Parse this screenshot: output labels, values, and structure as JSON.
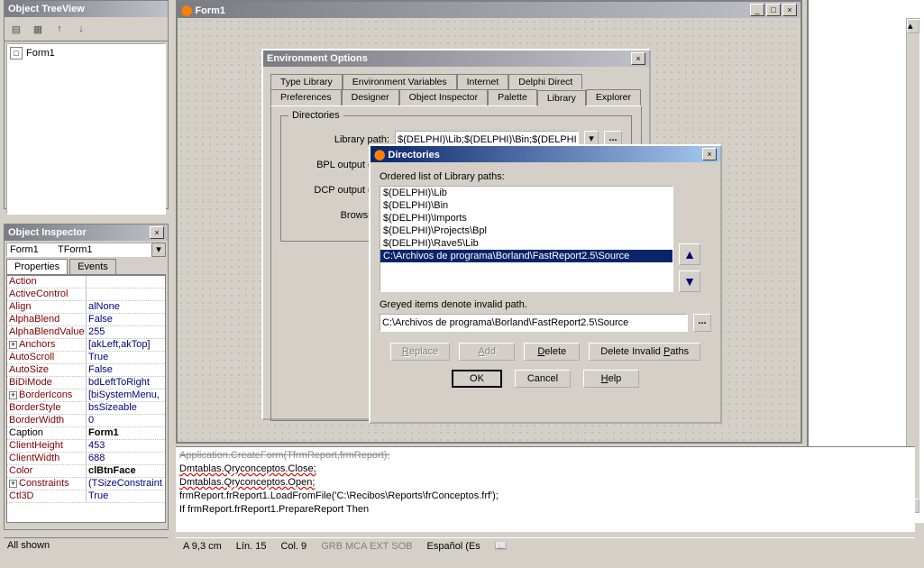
{
  "tree": {
    "title": "Object TreeView",
    "item": "Form1"
  },
  "inspector": {
    "title": "Object Inspector",
    "combo_name": "Form1",
    "combo_type": "TForm1",
    "tabs": {
      "properties": "Properties",
      "events": "Events"
    },
    "props": [
      {
        "name": "Action",
        "val": ""
      },
      {
        "name": "ActiveControl",
        "val": ""
      },
      {
        "name": "Align",
        "val": "alNone"
      },
      {
        "name": "AlphaBlend",
        "val": "False"
      },
      {
        "name": "AlphaBlendValue",
        "val": "255"
      },
      {
        "name": "Anchors",
        "val": "[akLeft,akTop]",
        "exp": true
      },
      {
        "name": "AutoScroll",
        "val": "True"
      },
      {
        "name": "AutoSize",
        "val": "False"
      },
      {
        "name": "BiDiMode",
        "val": "bdLeftToRight"
      },
      {
        "name": "BorderIcons",
        "val": "[biSystemMenu,",
        "exp": true
      },
      {
        "name": "BorderStyle",
        "val": "bsSizeable"
      },
      {
        "name": "BorderWidth",
        "val": "0"
      },
      {
        "name": "Caption",
        "val": "Form1",
        "bold": true,
        "black": true
      },
      {
        "name": "ClientHeight",
        "val": "453"
      },
      {
        "name": "ClientWidth",
        "val": "688"
      },
      {
        "name": "Color",
        "val": "clBtnFace",
        "bold": true
      },
      {
        "name": "Constraints",
        "val": "(TSizeConstraint",
        "exp": true
      },
      {
        "name": "Ctl3D",
        "val": "True"
      }
    ],
    "allshown": "All shown"
  },
  "form": {
    "title": "Form1"
  },
  "env": {
    "title": "Environment Options",
    "tabs1": [
      "Type Library",
      "Environment Variables",
      "Internet",
      "Delphi Direct"
    ],
    "tabs2": [
      "Preferences",
      "Designer",
      "Object Inspector",
      "Palette",
      "Library",
      "Explorer"
    ],
    "active_tab": "Library",
    "fieldset": "Directories",
    "rows": [
      {
        "label": "Library path:",
        "value": "$(DELPHI)\\Lib;$(DELPHI)\\Bin;$(DELPHI)\\Impor"
      },
      {
        "label": "BPL output direc",
        "value": ""
      },
      {
        "label": "DCP output direc",
        "value": ""
      },
      {
        "label": "Browsing p",
        "value": ""
      }
    ]
  },
  "dir": {
    "title": "Directories",
    "list_label": "Ordered list of Library paths:",
    "items": [
      "$(DELPHI)\\Lib",
      "$(DELPHI)\\Bin",
      "$(DELPHI)\\Imports",
      "$(DELPHI)\\Projects\\Bpl",
      "$(DELPHI)\\Rave5\\Lib",
      "C:\\Archivos de programa\\Borland\\FastReport2.5\\Source"
    ],
    "selected_index": 5,
    "grey_label": "Greyed items denote invalid path.",
    "edit_value": "C:\\Archivos de programa\\Borland\\FastReport2.5\\Source",
    "btn_replace": "Replace",
    "btn_add": "Add",
    "btn_delete": "Delete",
    "btn_delinv": "Delete Invalid Paths",
    "btn_ok": "OK",
    "btn_cancel": "Cancel",
    "btn_help": "Help"
  },
  "code": {
    "l1": "Application.CreateForm(TfrmReport,frmReport);",
    "l2": "Dmtablas.Qryconceptos.Close;",
    "l3": "Dmtablas.Qryconceptos.Open;",
    "l4": "frmReport.frReport1.LoadFromFile('C:\\Recibos\\Reports\\frConceptos.frf');",
    "l5": "If frmReport.frReport1.PrepareReport Then"
  },
  "status": {
    "pos": "A  9,3 cm",
    "line": "Lín.  15",
    "col": "Col.  9",
    "flags": [
      "GRB",
      "MCA",
      "EXT",
      "SOB"
    ],
    "lang": "Español (Es"
  }
}
